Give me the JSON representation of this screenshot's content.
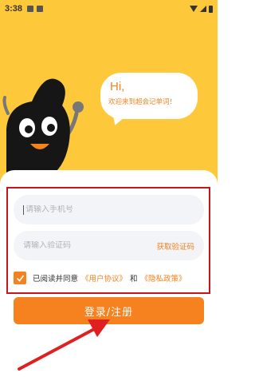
{
  "status_bar": {
    "time": "3:38",
    "icons": [
      "notification-a-icon",
      "message-icon",
      "wifi-icon",
      "signal-icon",
      "battery-icon"
    ]
  },
  "bubble": {
    "greeting": "Hi,",
    "message": "欢迎来到超会记单词！"
  },
  "form": {
    "phone_placeholder": "请输入手机号",
    "code_placeholder": "请输入验证码",
    "get_code_label": "获取验证码",
    "agree_text": "已阅读并同意",
    "user_agreement": "《用户协议》",
    "and_text": "和",
    "privacy_policy": "《隐私政策》",
    "agreed": true,
    "login_label": "登录/注册"
  },
  "colors": {
    "hero_background": "#fdc93a",
    "accent": "#f5821f",
    "annotation_red": "#c8151d"
  }
}
